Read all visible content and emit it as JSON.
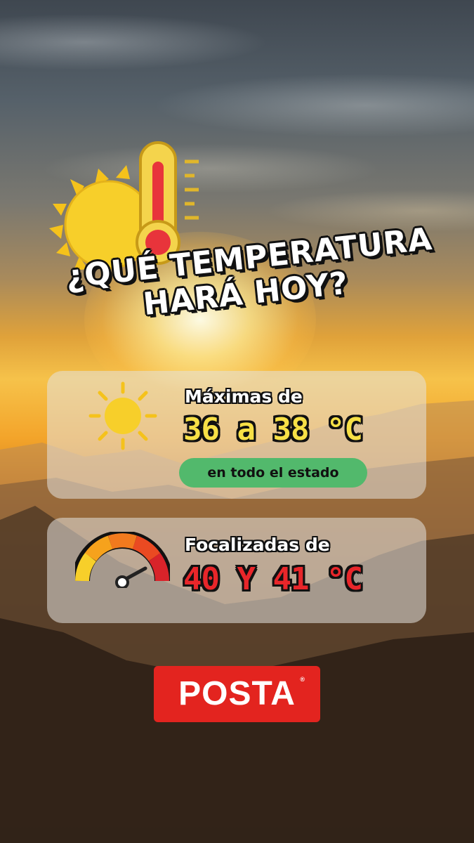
{
  "title": {
    "line1": "¿QUÉ TEMPERATURA",
    "line2": "HARÁ HOY?"
  },
  "card_max": {
    "label": "Máximas de",
    "value": "36 a 38 °C",
    "pill": "en todo el estado",
    "icon": "sun-icon"
  },
  "card_focal": {
    "label": "Focalizadas de",
    "value": "40 Y 41 °C",
    "icon": "gauge-icon"
  },
  "logo": {
    "text": "POSTA",
    "mark": "®"
  },
  "colors": {
    "value_yellow": "#f7e046",
    "value_red": "#e8262a",
    "pill_green": "#52b96c",
    "logo_red": "#e3241f"
  }
}
